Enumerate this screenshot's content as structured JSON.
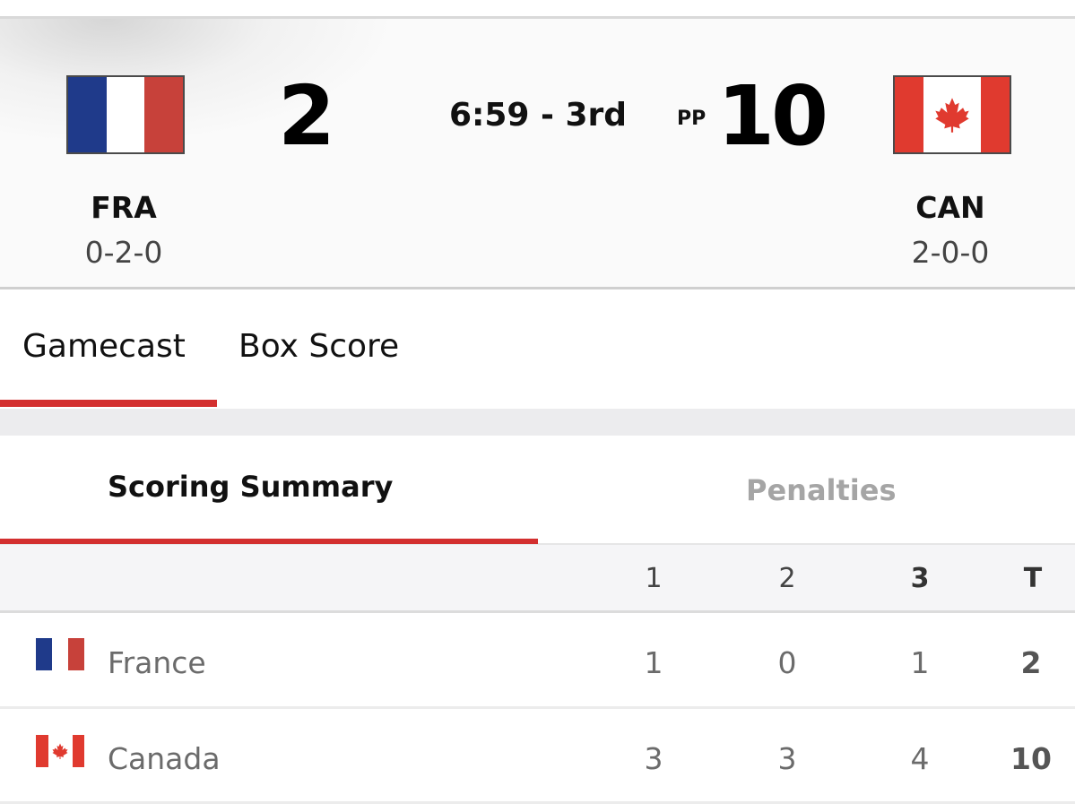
{
  "game": {
    "clock": "6:59 - 3rd",
    "power_play_label": "PP"
  },
  "away": {
    "abbr": "FRA",
    "record": "0-2-0",
    "score": "2",
    "flag": "france-flag"
  },
  "home": {
    "abbr": "CAN",
    "record": "2-0-0",
    "score": "10",
    "flag": "canada-flag"
  },
  "tabs": [
    {
      "label": "Gamecast",
      "active": true
    },
    {
      "label": "Box Score",
      "active": false
    }
  ],
  "summary_tabs": [
    {
      "label": "Scoring Summary",
      "active": true
    },
    {
      "label": "Penalties",
      "active": false
    }
  ],
  "table": {
    "headers": [
      "1",
      "2",
      "3",
      "T"
    ],
    "rows": [
      {
        "team": "France",
        "flag": "france-flag",
        "periods": [
          "1",
          "0",
          "1"
        ],
        "total": "2"
      },
      {
        "team": "Canada",
        "flag": "canada-flag",
        "periods": [
          "3",
          "3",
          "4"
        ],
        "total": "10"
      }
    ]
  },
  "colors": {
    "accent": "#d32f2f",
    "france_blue": "#1f3a8a",
    "france_red": "#c7413a",
    "canada_red": "#e03a2f"
  }
}
